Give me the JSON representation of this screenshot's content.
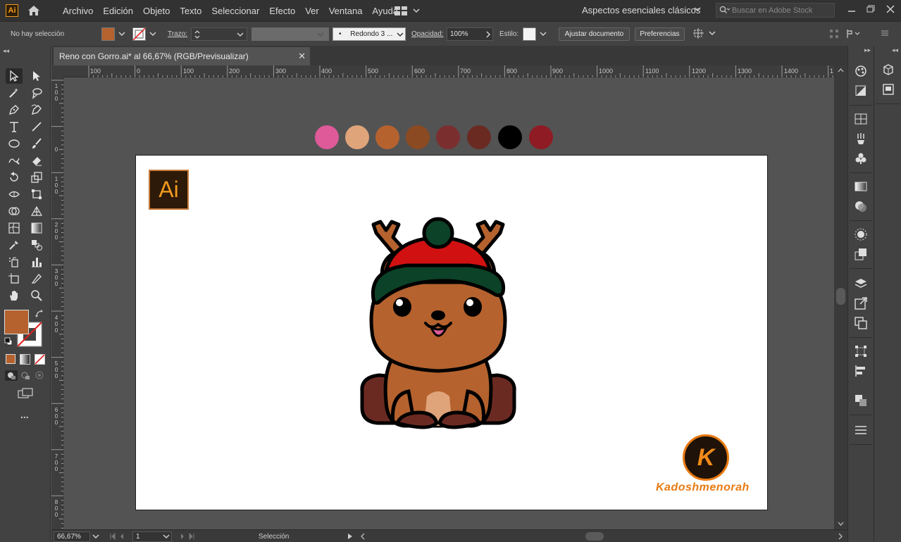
{
  "menubar": {
    "app_logo": "Ai",
    "items": [
      "Archivo",
      "Edición",
      "Objeto",
      "Texto",
      "Seleccionar",
      "Efecto",
      "Ver",
      "Ventana",
      "Ayuda"
    ],
    "workspace": "Aspectos esenciales clásicos",
    "search_placeholder": "Buscar en Adobe Stock"
  },
  "controlbar": {
    "selection_status": "No hay selección",
    "stroke_label": "Trazo:",
    "brush_label": "Redondo 3 ...",
    "brush_dot": "•",
    "opacity_label": "Opacidad:",
    "opacity_value": "100%",
    "style_label": "Estilo:",
    "fit_document_button": "Ajustar documento",
    "preferences_button": "Preferencias",
    "fill_color": "#b5622e"
  },
  "document": {
    "tab_title": "Reno con Gorro.ai* al 66,67% (RGB/Previsualizar)",
    "tab_close": "✕"
  },
  "rulers": {
    "horizontal": [
      "100",
      "0",
      "100",
      "200",
      "300",
      "400",
      "500",
      "600",
      "700",
      "800",
      "900",
      "1000",
      "1100",
      "1200",
      "1300",
      "1400",
      "1"
    ],
    "vertical": [
      [
        "1",
        "0",
        "0"
      ],
      [
        "0"
      ],
      [
        "1",
        "0",
        "0"
      ],
      [
        "2",
        "0",
        "0"
      ],
      [
        "3",
        "0",
        "0"
      ],
      [
        "4",
        "0",
        "0"
      ],
      [
        "5",
        "0",
        "0"
      ],
      [
        "6",
        "0",
        "0"
      ],
      [
        "7",
        "0",
        "0"
      ],
      [
        "8",
        "0",
        "0"
      ]
    ]
  },
  "palette": [
    "#de5a98",
    "#e0a47a",
    "#b5622e",
    "#8c4a22",
    "#7b2e2e",
    "#6a2a22",
    "#000000",
    "#8f1b24"
  ],
  "artwork": {
    "ai_badge": "Ai",
    "brand_letter": "K",
    "brand_name": "Kadoshmenorah"
  },
  "toolbar": {
    "fill_color": "#b5622e",
    "more": "..."
  },
  "statusbar": {
    "zoom": "66,67%",
    "artboard_number": "1",
    "tool_status": "Selección"
  }
}
